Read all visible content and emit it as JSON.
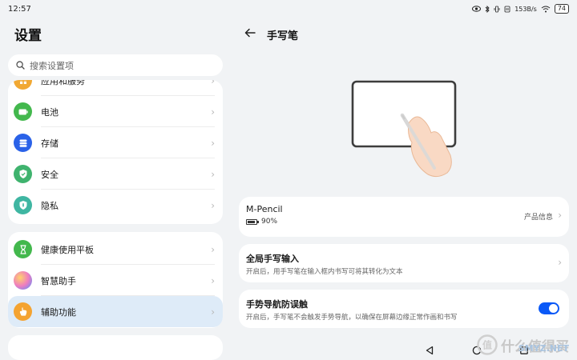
{
  "status_bar": {
    "time": "12:57",
    "net_speed": "153B/s",
    "battery": "74"
  },
  "left": {
    "title": "设置",
    "search_placeholder": "搜索设置项",
    "items_card1": [
      {
        "label": "应用和服务",
        "icon": "apps-icon",
        "color": "#f1a833"
      },
      {
        "label": "电池",
        "icon": "battery-icon",
        "color": "#43b84d"
      },
      {
        "label": "存储",
        "icon": "storage-icon",
        "color": "#2a62e8"
      },
      {
        "label": "安全",
        "icon": "shield-icon",
        "color": "#3fb36e"
      },
      {
        "label": "隐私",
        "icon": "privacy-icon",
        "color": "#3fb6a2"
      }
    ],
    "items_card2": [
      {
        "label": "健康使用平板",
        "icon": "hourglass-icon",
        "color": "#43b84d"
      },
      {
        "label": "智慧助手",
        "icon": "assistant-icon",
        "color": "#b07be6"
      },
      {
        "label": "辅助功能",
        "icon": "accessibility-icon",
        "color": "#f4a331"
      }
    ]
  },
  "right": {
    "title": "手写笔",
    "pencil": {
      "name": "M-Pencil",
      "battery": "90%",
      "battery_level": 0.9,
      "product_info": "产品信息"
    },
    "global_input": {
      "title": "全局手写输入",
      "desc": "开启后，用手写笔在输入框内书写可将其转化为文本"
    },
    "gesture": {
      "title": "手势导航防误触",
      "desc": "开启后，手写笔不会触发手势导航，以确保在屏幕边缘正常作画和书写",
      "enabled": true
    }
  },
  "watermark": {
    "text": "什么值得买",
    "site": "SMYZ.NET"
  },
  "colors": {
    "accent": "#0a59f7",
    "selected_bg": "#deebf8",
    "page_bg": "#f1f3f5"
  }
}
